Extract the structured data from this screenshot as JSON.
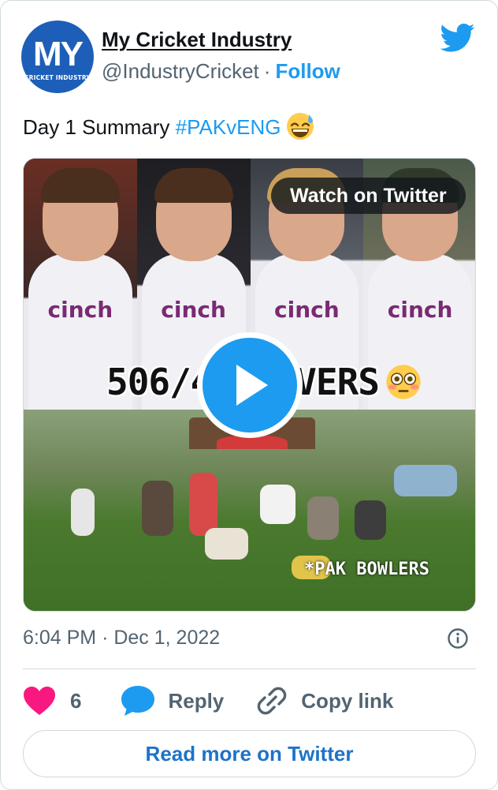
{
  "author": {
    "display_name": "My Cricket Industry",
    "handle": "@IndustryCricket",
    "separator": "·",
    "follow_label": "Follow",
    "avatar": {
      "logo_text": "MY",
      "logo_subtext": "CRICKET INDUSTRY"
    }
  },
  "tweet": {
    "text": "Day 1 Summary ",
    "hashtag": "#PAKvENG",
    "emoji": "grinning-face-with-sweat"
  },
  "media": {
    "watch_label": "Watch on Twitter",
    "score_left": "506/4",
    "score_right": "VERS",
    "sponsor": "cinch",
    "caption": "*PAK BOWLERS",
    "emoji": "flushed-face"
  },
  "meta": {
    "time": "6:04 PM",
    "separator": "·",
    "date": "Dec 1, 2022"
  },
  "actions": {
    "like_count": "6",
    "reply_label": "Reply",
    "copy_link_label": "Copy link"
  },
  "read_more_label": "Read more on Twitter",
  "colors": {
    "twitter_blue": "#1d9bf0",
    "like_pink": "#f91880",
    "secondary_text": "#536471",
    "avatar_blue": "#1d5fb8"
  }
}
